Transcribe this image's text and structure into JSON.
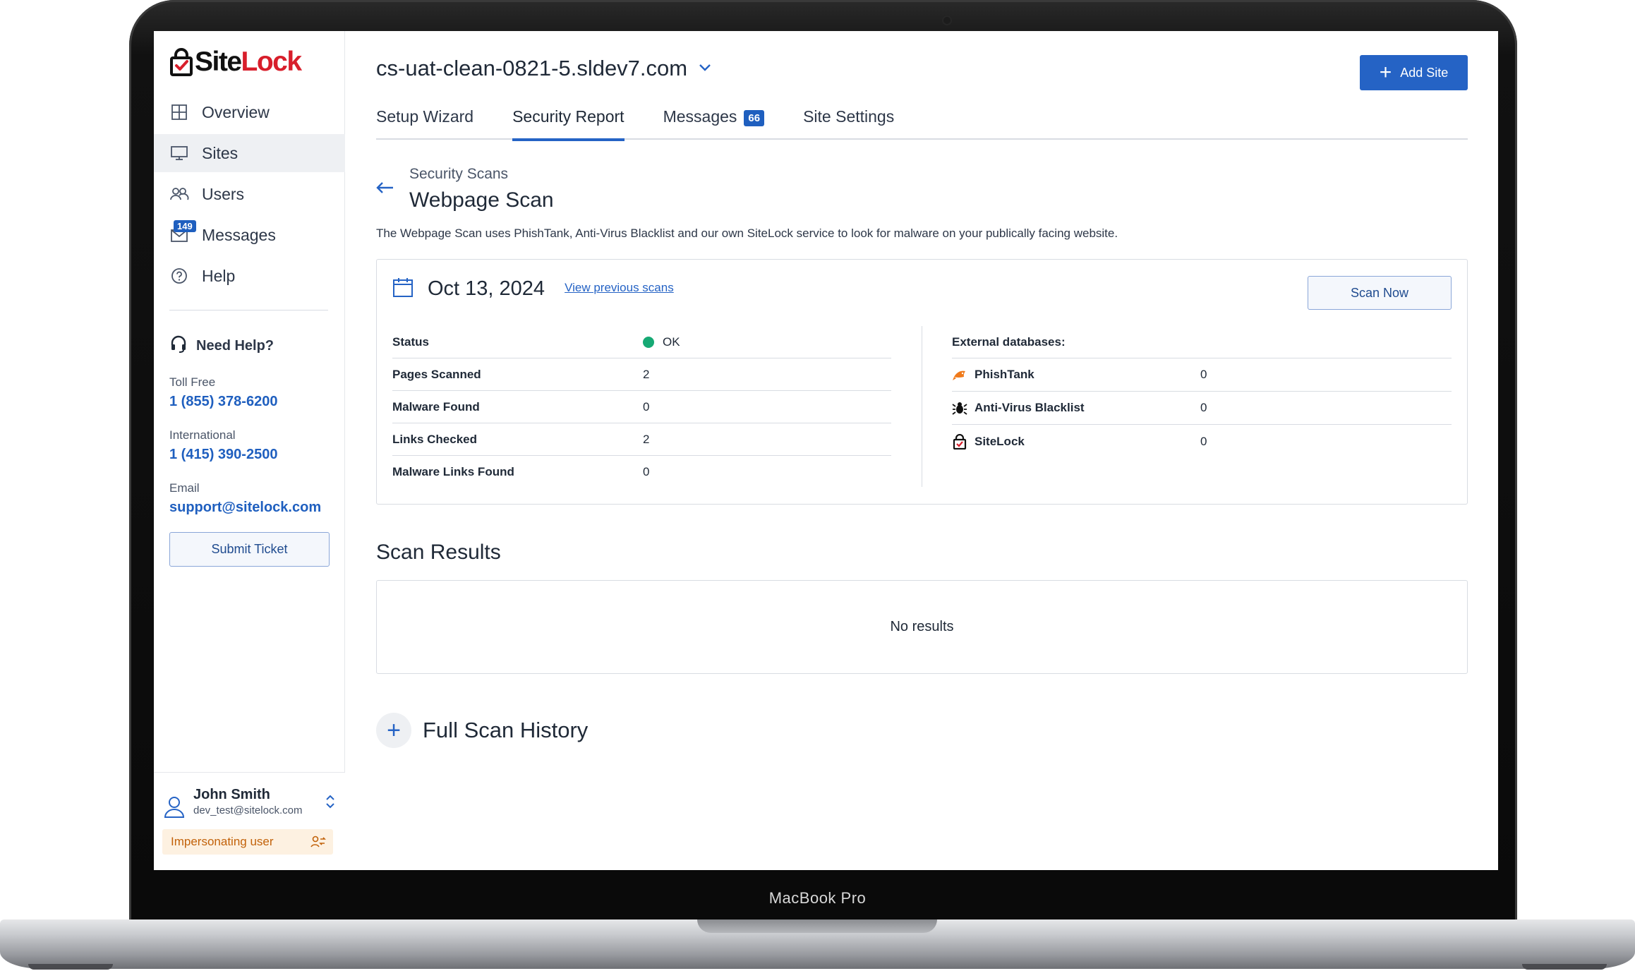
{
  "device": {
    "brand": "MacBook Pro"
  },
  "logo": {
    "part1": "Site",
    "part2": "Lock"
  },
  "sidebar": {
    "items": [
      {
        "label": "Overview",
        "icon": "grid-icon"
      },
      {
        "label": "Sites",
        "icon": "monitor-icon"
      },
      {
        "label": "Users",
        "icon": "users-icon"
      },
      {
        "label": "Messages",
        "icon": "mail-icon",
        "badge": "149"
      },
      {
        "label": "Help",
        "icon": "help-icon"
      }
    ],
    "active": "Sites"
  },
  "help": {
    "title": "Need Help?",
    "toll_free_label": "Toll Free",
    "toll_free": "1 (855) 378-6200",
    "international_label": "International",
    "international": "1 (415) 390-2500",
    "email_label": "Email",
    "email": "support@sitelock.com",
    "submit_ticket": "Submit Ticket"
  },
  "user": {
    "name": "John Smith",
    "email": "dev_test@sitelock.com",
    "impersonating": "Impersonating user"
  },
  "header": {
    "site": "cs-uat-clean-0821-5.sldev7.com",
    "add_site": "Add Site"
  },
  "tabs": [
    {
      "label": "Setup Wizard"
    },
    {
      "label": "Security Report",
      "active": true
    },
    {
      "label": "Messages",
      "badge": "66"
    },
    {
      "label": "Site Settings"
    }
  ],
  "page": {
    "crumb": "Security Scans",
    "title": "Webpage Scan",
    "description": "The Webpage Scan uses PhishTank, Anti-Virus Blacklist and our own SiteLock service to look for malware on your publically facing website."
  },
  "scan": {
    "date": "Oct 13, 2024",
    "view_previous": "View previous scans",
    "scan_now": "Scan Now",
    "stats": [
      {
        "label": "Status",
        "value": "OK"
      },
      {
        "label": "Pages Scanned",
        "value": "2"
      },
      {
        "label": "Malware Found",
        "value": "0"
      },
      {
        "label": "Links Checked",
        "value": "2"
      },
      {
        "label": "Malware Links Found",
        "value": "0"
      }
    ],
    "external_header": "External databases:",
    "external": [
      {
        "name": "PhishTank",
        "value": "0",
        "icon": "phishtank-icon"
      },
      {
        "name": "Anti-Virus Blacklist",
        "value": "0",
        "icon": "bug-icon"
      },
      {
        "name": "SiteLock",
        "value": "0",
        "icon": "sitelock-icon"
      }
    ],
    "status_color": "#16a974"
  },
  "results": {
    "title": "Scan Results",
    "empty": "No results"
  },
  "history": {
    "label": "Full Scan History"
  },
  "colors": {
    "accent": "#2563c5",
    "brand_red": "#d81e2b",
    "warning_bg": "#fdf1e1",
    "warning_text": "#c2620a"
  }
}
